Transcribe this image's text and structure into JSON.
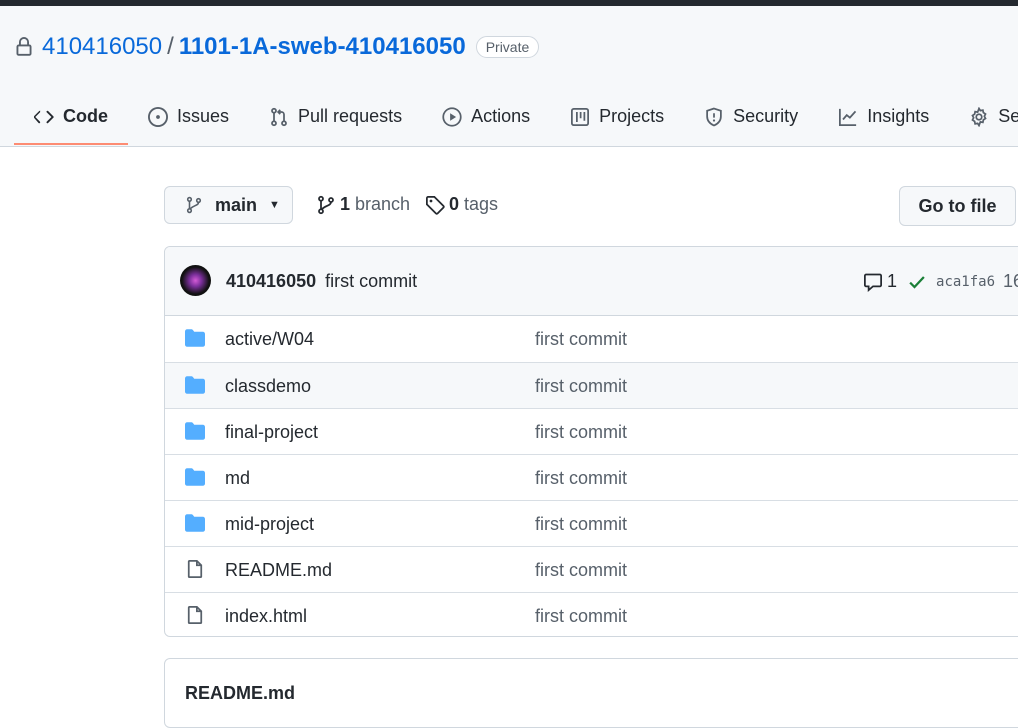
{
  "repo": {
    "owner": "410416050",
    "separator": "/",
    "name": "1101-1A-sweb-410416050",
    "visibility": "Private"
  },
  "tabs": [
    {
      "label": "Code",
      "icon": "code-icon",
      "selected": true
    },
    {
      "label": "Issues",
      "icon": "issue-opened-icon"
    },
    {
      "label": "Pull requests",
      "icon": "git-pull-request-icon"
    },
    {
      "label": "Actions",
      "icon": "play-icon"
    },
    {
      "label": "Projects",
      "icon": "table-icon"
    },
    {
      "label": "Security",
      "icon": "shield-icon"
    },
    {
      "label": "Insights",
      "icon": "graph-icon"
    },
    {
      "label": "Settin",
      "icon": "gear-icon"
    }
  ],
  "toolbar": {
    "branch": "main",
    "branch_count": "1",
    "branch_label": "branch",
    "tag_count": "0",
    "tag_label": "tags",
    "goto_file": "Go to file"
  },
  "commit": {
    "author": "410416050",
    "message": "first commit",
    "comments": "1",
    "status": "success",
    "sha": "aca1fa6",
    "time": "16"
  },
  "files": [
    {
      "name": "active/W04",
      "type": "dir",
      "message": "first commit"
    },
    {
      "name": "classdemo",
      "type": "dir",
      "message": "first commit"
    },
    {
      "name": "final-project",
      "type": "dir",
      "message": "first commit"
    },
    {
      "name": "md",
      "type": "dir",
      "message": "first commit"
    },
    {
      "name": "mid-project",
      "type": "dir",
      "message": "first commit"
    },
    {
      "name": "README.md",
      "type": "file",
      "message": "first commit"
    },
    {
      "name": "index.html",
      "type": "file",
      "message": "first commit"
    }
  ],
  "readme": {
    "title": "README.md"
  },
  "colors": {
    "link": "#0969da",
    "folder": "#54aeff",
    "success": "#1a7f37",
    "selected_tab_underline": "#fd8c73"
  }
}
